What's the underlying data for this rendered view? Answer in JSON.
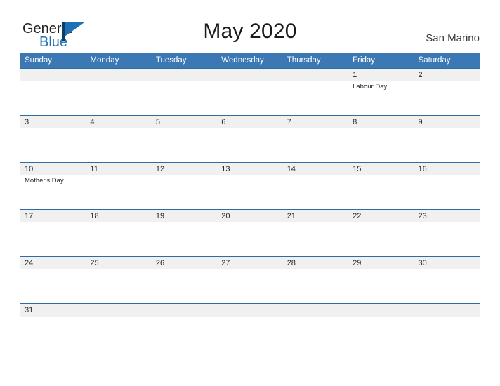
{
  "brand": {
    "name_part1": "General",
    "name_part2": "Blue",
    "flag_icon": "flag-icon",
    "colors": {
      "dark": "#231f20",
      "blue": "#1f6fb7",
      "pole": "#0d3f66"
    }
  },
  "header": {
    "title": "May 2020",
    "country": "San Marino"
  },
  "calendar": {
    "colors": {
      "header_bg": "#3c78b4",
      "header_text": "#ffffff",
      "row_band": "#f0f0f0",
      "row_border": "#2e6da4",
      "day_text": "#262626"
    },
    "weekdays": [
      "Sunday",
      "Monday",
      "Tuesday",
      "Wednesday",
      "Thursday",
      "Friday",
      "Saturday"
    ],
    "weeks": [
      {
        "days": [
          {
            "num": "",
            "events": []
          },
          {
            "num": "",
            "events": []
          },
          {
            "num": "",
            "events": []
          },
          {
            "num": "",
            "events": []
          },
          {
            "num": "",
            "events": []
          },
          {
            "num": "1",
            "events": [
              "Labour Day"
            ]
          },
          {
            "num": "2",
            "events": []
          }
        ]
      },
      {
        "days": [
          {
            "num": "3",
            "events": []
          },
          {
            "num": "4",
            "events": []
          },
          {
            "num": "5",
            "events": []
          },
          {
            "num": "6",
            "events": []
          },
          {
            "num": "7",
            "events": []
          },
          {
            "num": "8",
            "events": []
          },
          {
            "num": "9",
            "events": []
          }
        ]
      },
      {
        "days": [
          {
            "num": "10",
            "events": [
              "Mother's Day"
            ]
          },
          {
            "num": "11",
            "events": []
          },
          {
            "num": "12",
            "events": []
          },
          {
            "num": "13",
            "events": []
          },
          {
            "num": "14",
            "events": []
          },
          {
            "num": "15",
            "events": []
          },
          {
            "num": "16",
            "events": []
          }
        ]
      },
      {
        "days": [
          {
            "num": "17",
            "events": []
          },
          {
            "num": "18",
            "events": []
          },
          {
            "num": "19",
            "events": []
          },
          {
            "num": "20",
            "events": []
          },
          {
            "num": "21",
            "events": []
          },
          {
            "num": "22",
            "events": []
          },
          {
            "num": "23",
            "events": []
          }
        ]
      },
      {
        "days": [
          {
            "num": "24",
            "events": []
          },
          {
            "num": "25",
            "events": []
          },
          {
            "num": "26",
            "events": []
          },
          {
            "num": "27",
            "events": []
          },
          {
            "num": "28",
            "events": []
          },
          {
            "num": "29",
            "events": []
          },
          {
            "num": "30",
            "events": []
          }
        ]
      },
      {
        "last": true,
        "days": [
          {
            "num": "31",
            "events": []
          },
          {
            "num": "",
            "events": []
          },
          {
            "num": "",
            "events": []
          },
          {
            "num": "",
            "events": []
          },
          {
            "num": "",
            "events": []
          },
          {
            "num": "",
            "events": []
          },
          {
            "num": "",
            "events": []
          }
        ]
      }
    ]
  }
}
